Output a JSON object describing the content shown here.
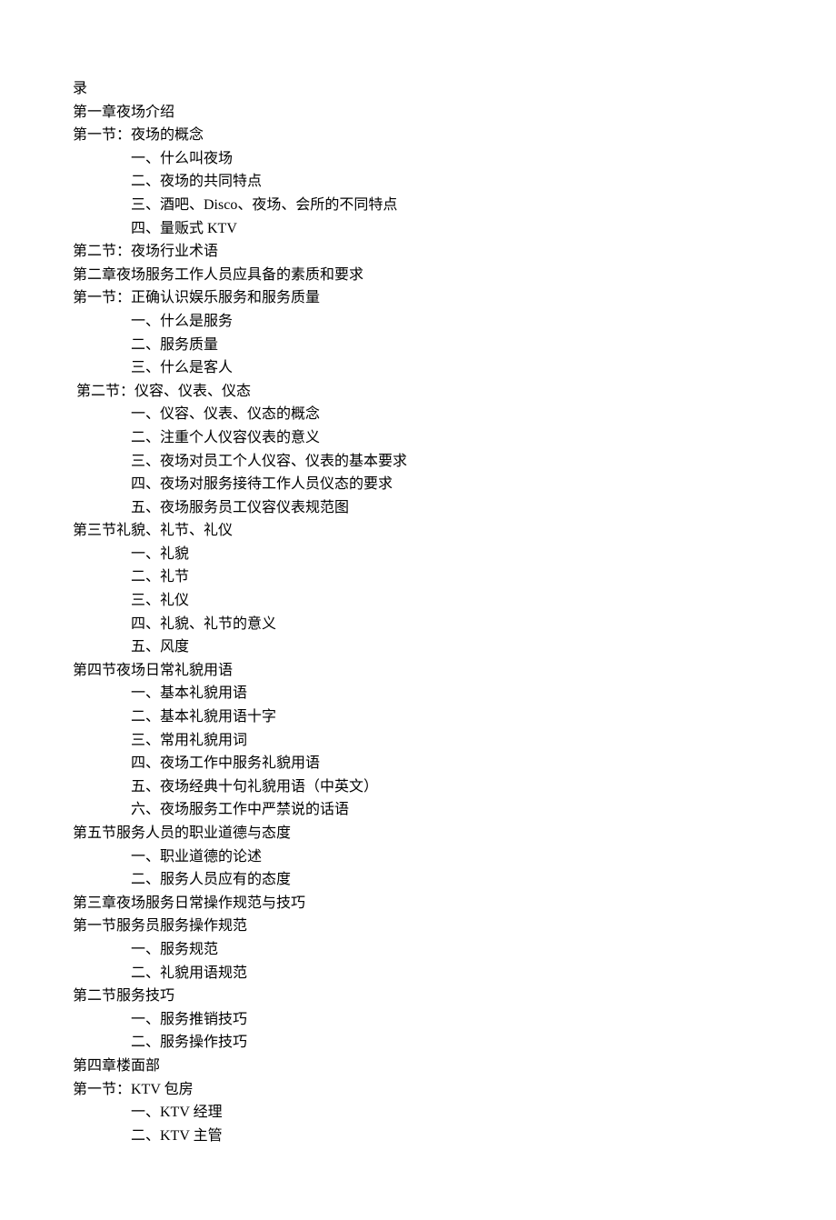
{
  "lines": [
    {
      "text": "录",
      "indent": 0
    },
    {
      "text": "第一章夜场介绍",
      "indent": 0
    },
    {
      "text": "第一节：夜场的概念",
      "indent": 0
    },
    {
      "text": "一、什么叫夜场",
      "indent": 1
    },
    {
      "text": "二、夜场的共同特点",
      "indent": 1
    },
    {
      "text": "三、酒吧、Disco、夜场、会所的不同特点",
      "indent": 1
    },
    {
      "text": "四、量贩式 KTV",
      "indent": 1
    },
    {
      "text": "第二节：夜场行业术语",
      "indent": 0
    },
    {
      "text": "第二章夜场服务工作人员应具备的素质和要求",
      "indent": 0
    },
    {
      "text": "第一节：正确认识娱乐服务和服务质量",
      "indent": 0
    },
    {
      "text": "一、什么是服务",
      "indent": 1
    },
    {
      "text": "二、服务质量",
      "indent": 1
    },
    {
      "text": "三、什么是客人",
      "indent": 1
    },
    {
      "text": " 第二节：仪容、仪表、仪态",
      "indent": 0
    },
    {
      "text": "一、仪容、仪表、仪态的概念",
      "indent": 1
    },
    {
      "text": "二、注重个人仪容仪表的意义",
      "indent": 1
    },
    {
      "text": "三、夜场对员工个人仪容、仪表的基本要求",
      "indent": 1
    },
    {
      "text": "四、夜场对服务接待工作人员仪态的要求",
      "indent": 1
    },
    {
      "text": "五、夜场服务员工仪容仪表规范图",
      "indent": 1
    },
    {
      "text": "第三节礼貌、礼节、礼仪",
      "indent": 0
    },
    {
      "text": "一、礼貌",
      "indent": 1
    },
    {
      "text": "二、礼节",
      "indent": 1
    },
    {
      "text": "三、礼仪",
      "indent": 1
    },
    {
      "text": "四、礼貌、礼节的意义",
      "indent": 1
    },
    {
      "text": "五、风度",
      "indent": 1
    },
    {
      "text": "第四节夜场日常礼貌用语",
      "indent": 0
    },
    {
      "text": "一、基本礼貌用语",
      "indent": 1
    },
    {
      "text": "二、基本礼貌用语十字",
      "indent": 1
    },
    {
      "text": "三、常用礼貌用词",
      "indent": 1
    },
    {
      "text": "四、夜场工作中服务礼貌用语",
      "indent": 1
    },
    {
      "text": "五、夜场经典十句礼貌用语（中英文）",
      "indent": 1
    },
    {
      "text": "六、夜场服务工作中严禁说的话语",
      "indent": 1
    },
    {
      "text": "第五节服务人员的职业道德与态度",
      "indent": 0
    },
    {
      "text": "一、职业道德的论述",
      "indent": 1
    },
    {
      "text": "二、服务人员应有的态度",
      "indent": 1
    },
    {
      "text": "第三章夜场服务日常操作规范与技巧",
      "indent": 0
    },
    {
      "text": "第一节服务员服务操作规范",
      "indent": 0
    },
    {
      "text": "一、服务规范",
      "indent": 1
    },
    {
      "text": "二、礼貌用语规范",
      "indent": 1
    },
    {
      "text": "第二节服务技巧",
      "indent": 0
    },
    {
      "text": "一、服务推销技巧",
      "indent": 1
    },
    {
      "text": "二、服务操作技巧",
      "indent": 1
    },
    {
      "text": "第四章楼面部",
      "indent": 0
    },
    {
      "text": "第一节：KTV 包房",
      "indent": 0
    },
    {
      "text": "一、KTV 经理",
      "indent": 1
    },
    {
      "text": "二、KTV 主管",
      "indent": 1
    }
  ]
}
